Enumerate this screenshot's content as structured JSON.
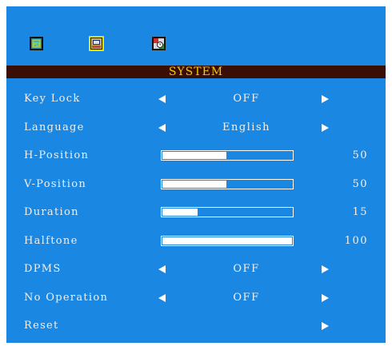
{
  "window": {
    "title": "SYSTEM"
  },
  "tabs": [
    {
      "icon": "picture-icon"
    },
    {
      "icon": "system-icon",
      "selected": true
    },
    {
      "icon": "clock-icon"
    }
  ],
  "colors": {
    "background": "#1a87e3",
    "title_bar": "#3a0e05",
    "title_text": "#f5c800",
    "text": "#f0f0f0"
  },
  "menu": {
    "key_lock": {
      "label": "Key Lock",
      "value": "OFF"
    },
    "language": {
      "label": "Language",
      "value": "English"
    },
    "h_position": {
      "label": "H-Position",
      "value": "50",
      "level": 0.5
    },
    "v_position": {
      "label": "V-Position",
      "value": "50",
      "level": 0.5
    },
    "duration": {
      "label": "Duration",
      "value": "15",
      "level": 0.28
    },
    "halftone": {
      "label": "Halftone",
      "value": "100",
      "level": 1.0
    },
    "dpms": {
      "label": "DPMS",
      "value": "OFF"
    },
    "no_operation": {
      "label": "No Operation",
      "value": "OFF"
    },
    "reset": {
      "label": "Reset"
    }
  }
}
